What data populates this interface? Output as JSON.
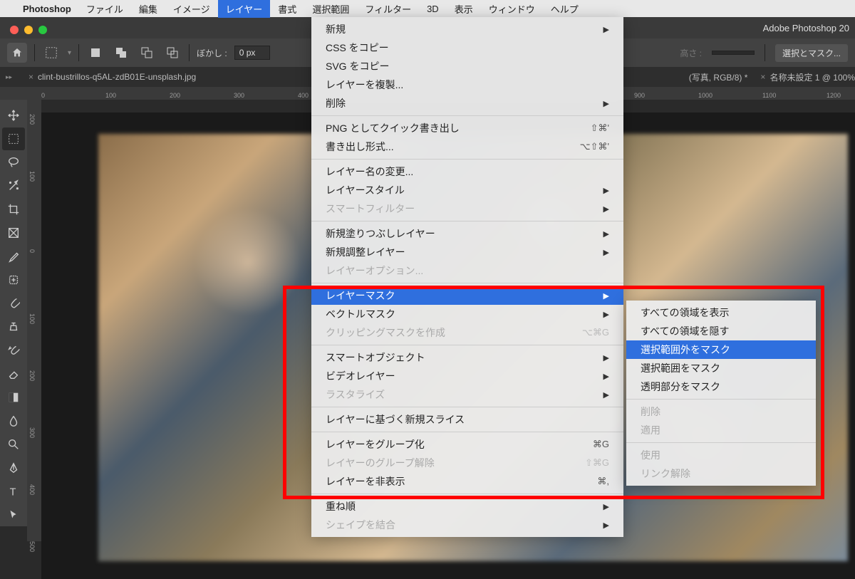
{
  "menubar": {
    "app": "Photoshop",
    "items": [
      "ファイル",
      "編集",
      "イメージ",
      "レイヤー",
      "書式",
      "選択範囲",
      "フィルター",
      "3D",
      "表示",
      "ウィンドウ",
      "ヘルプ"
    ],
    "selected_index": 3
  },
  "window_title": "Adobe Photoshop 20",
  "optionsbar": {
    "blur_label": "ぼかし :",
    "blur_value": "0 px",
    "height_label": "高さ :",
    "mask_button": "選択とマスク..."
  },
  "tabs": [
    {
      "title": "clint-bustrillos-q5AL-zdB01E-unsplash.jpg"
    },
    {
      "title": "(写真, RGB/8) *"
    },
    {
      "title": "名称未設定 1 @ 100%"
    }
  ],
  "ruler_h": [
    "0",
    "100",
    "200",
    "300",
    "400",
    "900",
    "1000",
    "1100",
    "1200"
  ],
  "ruler_v": [
    "200",
    "100",
    "0",
    "100",
    "200",
    "300",
    "400",
    "500"
  ],
  "layer_menu": [
    {
      "label": "新規",
      "arrow": true
    },
    {
      "label": "CSS をコピー"
    },
    {
      "label": "SVG をコピー"
    },
    {
      "label": "レイヤーを複製..."
    },
    {
      "label": "削除",
      "arrow": true
    },
    {
      "sep": true
    },
    {
      "label": "PNG としてクイック書き出し",
      "shortcut": "⇧⌘'"
    },
    {
      "label": "書き出し形式...",
      "shortcut": "⌥⇧⌘'"
    },
    {
      "sep": true
    },
    {
      "label": "レイヤー名の変更..."
    },
    {
      "label": "レイヤースタイル",
      "arrow": true
    },
    {
      "label": "スマートフィルター",
      "arrow": true,
      "disabled": true
    },
    {
      "sep": true
    },
    {
      "label": "新規塗りつぶしレイヤー",
      "arrow": true
    },
    {
      "label": "新規調整レイヤー",
      "arrow": true
    },
    {
      "label": "レイヤーオプション...",
      "disabled": true
    },
    {
      "sep": true
    },
    {
      "label": "レイヤーマスク",
      "arrow": true,
      "highlighted": true
    },
    {
      "label": "ベクトルマスク",
      "arrow": true
    },
    {
      "label": "クリッピングマスクを作成",
      "shortcut": "⌥⌘G",
      "disabled": true
    },
    {
      "sep": true
    },
    {
      "label": "スマートオブジェクト",
      "arrow": true
    },
    {
      "label": "ビデオレイヤー",
      "arrow": true
    },
    {
      "label": "ラスタライズ",
      "arrow": true,
      "disabled": true
    },
    {
      "sep": true
    },
    {
      "label": "レイヤーに基づく新規スライス"
    },
    {
      "sep": true
    },
    {
      "label": "レイヤーをグループ化",
      "shortcut": "⌘G"
    },
    {
      "label": "レイヤーのグループ解除",
      "shortcut": "⇧⌘G",
      "disabled": true
    },
    {
      "label": "レイヤーを非表示",
      "shortcut": "⌘,"
    },
    {
      "sep": true
    },
    {
      "label": "重ね順",
      "arrow": true
    },
    {
      "label": "シェイプを結合",
      "arrow": true,
      "disabled": true
    }
  ],
  "submenu": [
    {
      "label": "すべての領域を表示"
    },
    {
      "label": "すべての領域を隠す"
    },
    {
      "label": "選択範囲外をマスク",
      "highlighted": true
    },
    {
      "label": "選択範囲をマスク"
    },
    {
      "label": "透明部分をマスク"
    },
    {
      "sep": true
    },
    {
      "label": "削除",
      "disabled": true
    },
    {
      "label": "適用",
      "disabled": true
    },
    {
      "sep": true
    },
    {
      "label": "使用",
      "disabled": true
    },
    {
      "label": "リンク解除",
      "disabled": true
    }
  ]
}
